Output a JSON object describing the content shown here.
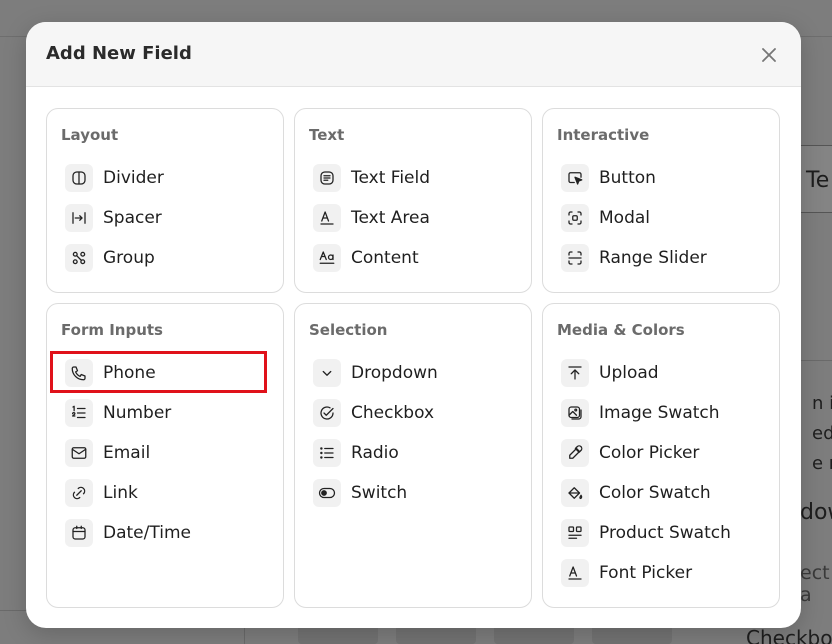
{
  "modal": {
    "title": "Add New Field",
    "close_label": "×"
  },
  "sections": {
    "layout": {
      "title": "Layout",
      "items": [
        "Divider",
        "Spacer",
        "Group"
      ]
    },
    "text": {
      "title": "Text",
      "items": [
        "Text Field",
        "Text Area",
        "Content"
      ]
    },
    "interactive": {
      "title": "Interactive",
      "items": [
        "Button",
        "Modal",
        "Range Slider"
      ]
    },
    "form_inputs": {
      "title": "Form Inputs",
      "items": [
        "Phone",
        "Number",
        "Email",
        "Link",
        "Date/Time"
      ]
    },
    "selection": {
      "title": "Selection",
      "items": [
        "Dropdown",
        "Checkbox",
        "Radio",
        "Switch"
      ]
    },
    "media_colors": {
      "title": "Media & Colors",
      "items": [
        "Upload",
        "Image Swatch",
        "Color Picker",
        "Color Swatch",
        "Product Swatch",
        "Font Picker"
      ]
    }
  },
  "background": {
    "panel_text": "Te",
    "para_lines": [
      "n ips",
      "ed c",
      "e ma"
    ],
    "heading": "dow",
    "select_placeholder": "ect a",
    "checkbox_label": "Checkbo"
  },
  "colors": {
    "highlight": "#e0111a",
    "overlay": "#7d7d7d"
  }
}
